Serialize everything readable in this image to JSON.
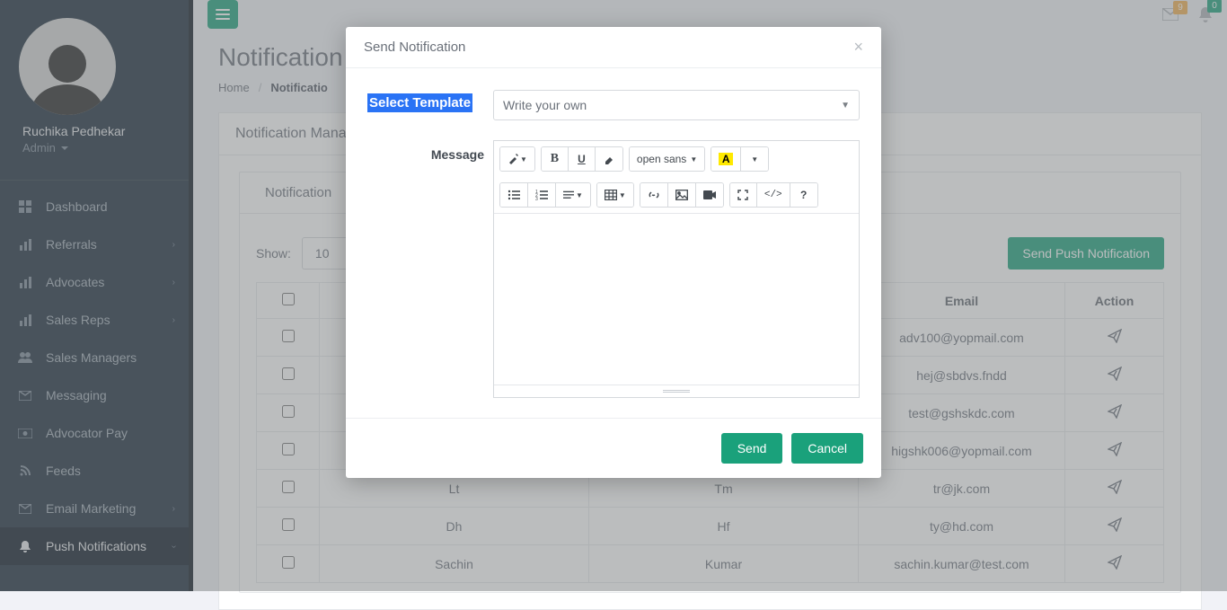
{
  "sidebar": {
    "profile": {
      "name": "Ruchika Pedhekar",
      "role": "Admin"
    },
    "items": [
      {
        "icon": "dashboard",
        "label": "Dashboard",
        "chevron": false
      },
      {
        "icon": "bar",
        "label": "Referrals",
        "chevron": true
      },
      {
        "icon": "bar",
        "label": "Advocates",
        "chevron": true
      },
      {
        "icon": "bar",
        "label": "Sales Reps",
        "chevron": true
      },
      {
        "icon": "users",
        "label": "Sales Managers",
        "chevron": false
      },
      {
        "icon": "envelope",
        "label": "Messaging",
        "chevron": false
      },
      {
        "icon": "money",
        "label": "Advocator Pay",
        "chevron": false
      },
      {
        "icon": "rss",
        "label": "Feeds",
        "chevron": false
      },
      {
        "icon": "envelope",
        "label": "Email Marketing",
        "chevron": true
      },
      {
        "icon": "bell",
        "label": "Push Notifications",
        "chevron": true,
        "active": true
      }
    ]
  },
  "topbar": {
    "msg_count": "9",
    "bell_count": "0"
  },
  "page": {
    "title": "Notification",
    "breadcrumb_home": "Home",
    "breadcrumb_active_prefix": "Notificatio",
    "card_header": "Notification Mana",
    "tab_notification": "Notification",
    "show_label": "Show:",
    "show_value": "10",
    "push_button": "Send Push Notification",
    "columns": {
      "email": "Email",
      "action": "Action"
    },
    "rows": [
      {
        "c1": "",
        "c2": "",
        "email": "adv100@yopmail.com"
      },
      {
        "c1": "",
        "c2": "",
        "email": "hej@sbdvs.fndd"
      },
      {
        "c1": "",
        "c2": "",
        "email": "test@gshskdc.com"
      },
      {
        "c1": "",
        "c2": "",
        "email": "higshk006@yopmail.com"
      },
      {
        "c1": "",
        "c2": "",
        "email": "tr@jk.com"
      },
      {
        "c1": "Dh",
        "c2": "Hf",
        "email": "ty@hd.com"
      },
      {
        "c1": "Sachin",
        "c2": "Kumar",
        "email": "sachin.kumar@test.com"
      }
    ],
    "row4_partial_c1": "Lt",
    "row4_partial_c2": "Tm"
  },
  "modal": {
    "title": "Send Notification",
    "select_template_label": "Select Template",
    "template_value": "Write your own",
    "message_label": "Message",
    "font_name": "open sans",
    "send": "Send",
    "cancel": "Cancel"
  }
}
